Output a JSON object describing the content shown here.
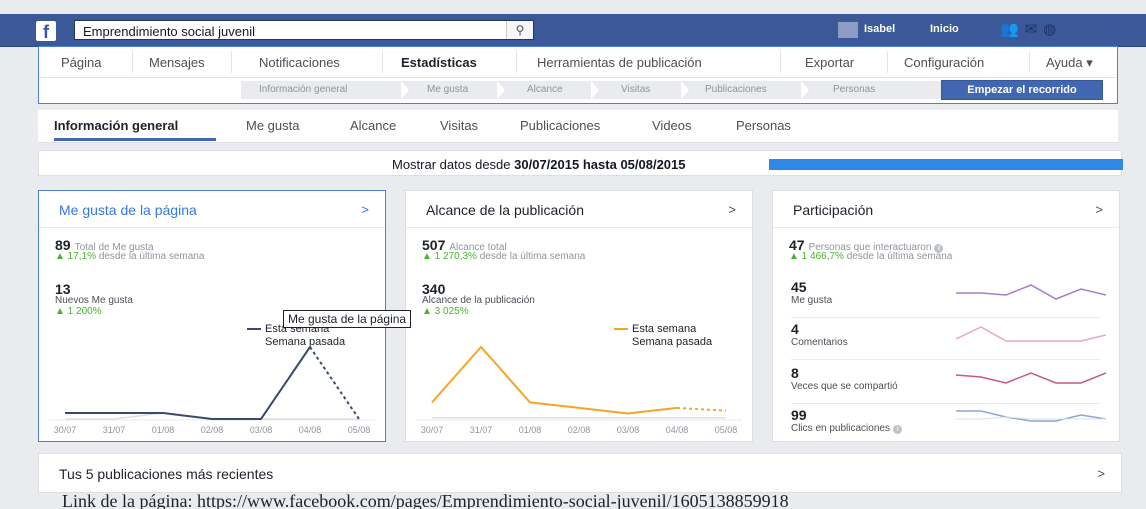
{
  "topbar": {
    "logo": "f",
    "search_value": "Emprendimiento social juvenil",
    "search_icon": "search-icon",
    "user_name": "Isabel",
    "home_label": "Inicio",
    "icons": [
      "friends-icon",
      "messages-icon",
      "globe-icon"
    ]
  },
  "nav": {
    "items": [
      "Página",
      "Mensajes",
      "Notificaciones",
      "Estadísticas",
      "Herramientas de publicación",
      "Exportar",
      "Configuración",
      "Ayuda ▾"
    ],
    "active": "Estadísticas",
    "subnav": [
      "Información general",
      "Me gusta",
      "Alcance",
      "Visitas",
      "Publicaciones",
      "Personas"
    ],
    "tour_button": "Empezar el recorrido"
  },
  "tabs": {
    "items": [
      "Información general",
      "Me gusta",
      "Alcance",
      "Visitas",
      "Publicaciones",
      "Videos",
      "Personas"
    ],
    "active": "Información general"
  },
  "daterange": {
    "prefix": "Mostrar datos desde",
    "from": "30/07/2015",
    "mid": "hasta",
    "to": "05/08/2015"
  },
  "likes_card": {
    "title": "Me gusta de la página",
    "chevron": ">",
    "total_value": "89",
    "total_label": "Total de Me gusta",
    "total_change": "▲ 17,1%",
    "total_change_label": "desde la última semana",
    "new_value": "13",
    "new_label": "Nuevos Me gusta",
    "new_change": "▲ 1 200%",
    "legend_this": "Esta semana",
    "legend_last": "Semana pasada",
    "tooltip": "Me gusta de la página"
  },
  "reach_card": {
    "title": "Alcance de la publicación",
    "chevron": ">",
    "total_value": "507",
    "total_label": "Alcance total",
    "total_change": "▲ 1 270,3%",
    "total_change_label": "desde la última semana",
    "post_value": "340",
    "post_label": "Alcance de la publicación",
    "post_change": "▲ 3 025%",
    "legend_this": "Esta semana",
    "legend_last": "Semana pasada"
  },
  "engagement_card": {
    "title": "Participación",
    "chevron": ">",
    "total_value": "47",
    "total_label": "Personas que interactuaron",
    "total_change": "▲ 1 466,7%",
    "total_change_label": "desde la última semana",
    "metrics": [
      {
        "value": "45",
        "label": "Me gusta",
        "color": "#a97dc6"
      },
      {
        "value": "4",
        "label": "Comentarios",
        "color": "#e5a9bd"
      },
      {
        "value": "8",
        "label": "Veces que se compartió",
        "color": "#c45a7d"
      },
      {
        "value": "99",
        "label": "Clics en publicaciones",
        "color": "#8da6d4"
      }
    ]
  },
  "colors": {
    "likes_line": "#3b4a6b",
    "reach_line": "#f5a623",
    "previous_line": "#dddfe2"
  },
  "chart_data": [
    {
      "type": "line",
      "x": [
        "30/07",
        "31/07",
        "01/08",
        "02/08",
        "03/08",
        "04/08",
        "05/08"
      ],
      "series": [
        {
          "name": "Esta semana",
          "values": [
            1,
            1,
            1,
            0,
            0,
            12,
            0
          ]
        },
        {
          "name": "Semana pasada",
          "values": [
            0,
            0,
            1,
            0,
            0,
            0,
            0
          ]
        }
      ],
      "title": "Me gusta de la página"
    },
    {
      "type": "line",
      "x": [
        "30/07",
        "31/07",
        "01/08",
        "02/08",
        "03/08",
        "04/08",
        "05/08"
      ],
      "series": [
        {
          "name": "Esta semana",
          "values": [
            60,
            260,
            60,
            40,
            20,
            40,
            30
          ]
        },
        {
          "name": "Semana pasada",
          "values": [
            4,
            4,
            4,
            4,
            4,
            4,
            4
          ]
        }
      ],
      "title": "Alcance de la publicación"
    }
  ],
  "recent": {
    "title": "Tus 5 publicaciones más recientes",
    "chevron": ">"
  },
  "footer_text": "Link de la página: https://www.facebook.com/pages/Emprendimiento-social-juvenil/1605138859918"
}
